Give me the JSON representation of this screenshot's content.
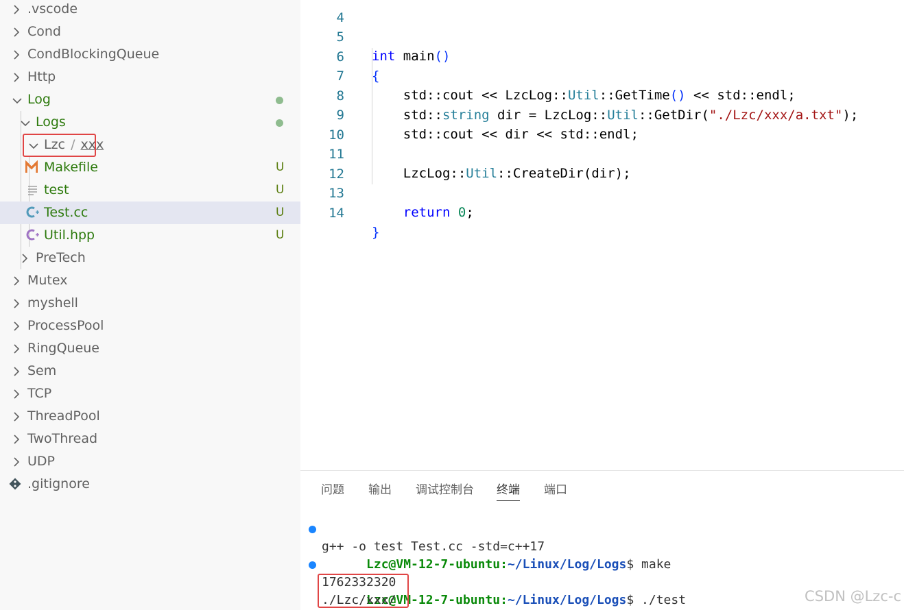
{
  "explorer": {
    "items": [
      {
        "label": ".vscode"
      },
      {
        "label": "Cond"
      },
      {
        "label": "CondBlockingQueue"
      },
      {
        "label": "Http"
      },
      {
        "label": "Log"
      },
      {
        "label": "Logs"
      },
      {
        "label_a": "Lzc",
        "label_sep": "/",
        "label_b": "xxx"
      },
      {
        "label": "Makefile",
        "badge": "U"
      },
      {
        "label": "test",
        "badge": "U"
      },
      {
        "label": "Test.cc",
        "badge": "U"
      },
      {
        "label": "Util.hpp",
        "badge": "U"
      },
      {
        "label": "PreTech"
      },
      {
        "label": "Mutex"
      },
      {
        "label": "myshell"
      },
      {
        "label": "ProcessPool"
      },
      {
        "label": "RingQueue"
      },
      {
        "label": "Sem"
      },
      {
        "label": "TCP"
      },
      {
        "label": "ThreadPool"
      },
      {
        "label": "TwoThread"
      },
      {
        "label": "UDP"
      },
      {
        "label": ".gitignore"
      }
    ],
    "colors": {
      "modified_dot": "#8fbc8f",
      "untracked_badge": "#587c0c",
      "selected_row": "#e4e6f1"
    }
  },
  "editor": {
    "lines": [
      {
        "no": "4"
      },
      {
        "no": "5",
        "t1": "int",
        "t2": " main",
        "t3": "()"
      },
      {
        "no": "6",
        "t1": "{"
      },
      {
        "no": "7",
        "t1": "    std::cout << LzcLog::",
        "t2": "Util",
        "t3": "::GetTime",
        "t4": "()",
        "t5": " << std::endl;"
      },
      {
        "no": "8",
        "t1": "    std::",
        "t2": "string",
        "t3": " dir = LzcLog::",
        "t4": "Util",
        "t5": "::GetDir(",
        "t6": "\"./Lzc/xxx/a.txt\"",
        "t7": ");"
      },
      {
        "no": "9",
        "t1": "    std::cout << dir << std::endl;"
      },
      {
        "no": "10"
      },
      {
        "no": "11",
        "t1": "    LzcLog::",
        "t2": "Util",
        "t3": "::CreateDir(dir);"
      },
      {
        "no": "12"
      },
      {
        "no": "13",
        "t1": "    ",
        "t2": "return",
        "t3": " ",
        "t4": "0",
        "t5": ";"
      },
      {
        "no": "14",
        "t1": "}"
      }
    ]
  },
  "panel": {
    "tabs": [
      "问题",
      "输出",
      "调试控制台",
      "终端",
      "端口"
    ],
    "active_tab": "终端",
    "terminal": [
      {
        "user": "Lzc@VM-12-7-ubuntu",
        "colon": ":",
        "path": "~/Linux/Log/Logs",
        "prompt": "$ ",
        "cmd": "make"
      },
      {
        "text": "g++ -o test Test.cc -std=c++17"
      },
      {
        "user": "Lzc@VM-12-7-ubuntu",
        "colon": ":",
        "path": "~/Linux/Log/Logs",
        "prompt": "$ ",
        "cmd": "./test"
      },
      {
        "text": "1762332320"
      },
      {
        "text": "./Lzc/xxx/"
      }
    ]
  },
  "watermark": "CSDN @Lzc-c"
}
